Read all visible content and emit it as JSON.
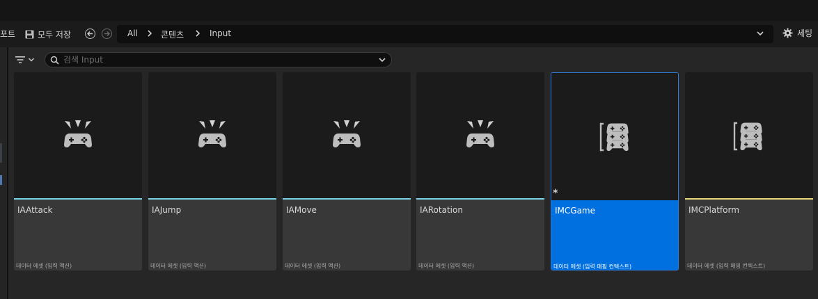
{
  "toolbar": {
    "cut_left_label": "포트",
    "save_all_label": "모두 저장",
    "settings_label": "세팅"
  },
  "breadcrumb": {
    "items": [
      "All",
      "콘텐츠",
      "Input"
    ]
  },
  "search": {
    "placeholder": "검색 Input"
  },
  "colors": {
    "input_action_bar": "#79d3e6",
    "mapping_context_bar": "#e8d879",
    "selected": "#0070e0"
  },
  "assets": [
    {
      "name": "IAAttack",
      "type": "데이터 에셋 (입력 액션)",
      "icon": "gamepad-action-icon"
    },
    {
      "name": "IAJump",
      "type": "데이터 에셋 (입력 액션)",
      "icon": "gamepad-action-icon"
    },
    {
      "name": "IAMove",
      "type": "데이터 에셋 (입력 액션)",
      "icon": "gamepad-action-icon"
    },
    {
      "name": "IARotation",
      "type": "데이터 에셋 (입력 액션)",
      "icon": "gamepad-action-icon"
    },
    {
      "name": "IMCGame",
      "type": "데이터 에셋 (입력 매핑 컨텍스트)",
      "icon": "mapping-context-icon",
      "selected": true,
      "unsaved_marker": "*"
    },
    {
      "name": "IMCPlatform",
      "type": "데이터 에셋 (입력 매핑 컨텍스트)",
      "icon": "mapping-context-icon"
    }
  ]
}
